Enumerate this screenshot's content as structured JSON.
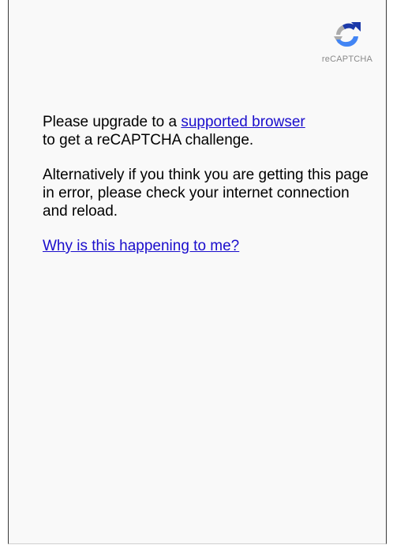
{
  "logo": {
    "label": "reCAPTCHA",
    "icon": "recaptcha-logo-icon"
  },
  "message": {
    "line1_prefix": "Please upgrade to a ",
    "supported_browser_link": "supported browser",
    "line1_suffix": "to get a reCAPTCHA challenge.",
    "alternative": "Alternatively if you think you are getting this page in error, please check your internet connection and reload.",
    "why_link": "Why is this happening to me?"
  },
  "colors": {
    "link": "#1a0dcc",
    "logo_dark_blue": "#1c3aa9",
    "logo_blue": "#4285f4",
    "logo_gray": "#ababab"
  }
}
